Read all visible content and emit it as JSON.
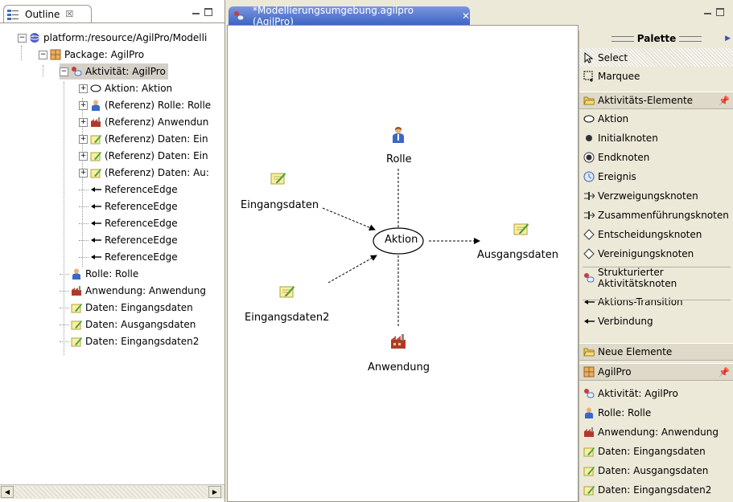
{
  "outline": {
    "tab_label": "Outline",
    "tab_close": "☒",
    "tree": [
      {
        "label": "platform:/resource/AgilPro/Modelli",
        "icon": "platform-icon",
        "expander": "−"
      },
      {
        "label": "Package: AgilPro",
        "icon": "package-icon",
        "expander": "−"
      },
      {
        "label": "Aktivität: AgilPro",
        "icon": "activity-icon",
        "expander": "−"
      },
      {
        "label": "Aktion: Aktion",
        "icon": "action-icon",
        "expander": "+"
      },
      {
        "label": "(Referenz) Rolle: Rolle",
        "icon": "role-icon",
        "expander": "+"
      },
      {
        "label": "(Referenz) Anwendun",
        "icon": "application-icon",
        "expander": "+"
      },
      {
        "label": "(Referenz) Daten: Ein",
        "icon": "data-icon",
        "expander": "+"
      },
      {
        "label": "(Referenz) Daten: Ein",
        "icon": "data-icon",
        "expander": "+"
      },
      {
        "label": "(Referenz) Daten: Au:",
        "icon": "data-icon",
        "expander": "+"
      },
      {
        "label": "ReferenceEdge",
        "icon": "edge-icon"
      },
      {
        "label": "ReferenceEdge",
        "icon": "edge-icon"
      },
      {
        "label": "ReferenceEdge",
        "icon": "edge-icon"
      },
      {
        "label": "ReferenceEdge",
        "icon": "edge-icon"
      },
      {
        "label": "ReferenceEdge",
        "icon": "edge-icon"
      },
      {
        "label": "Rolle: Rolle",
        "icon": "role-icon"
      },
      {
        "label": "Anwendung: Anwendung",
        "icon": "application-icon"
      },
      {
        "label": "Daten: Eingangsdaten",
        "icon": "data-icon"
      },
      {
        "label": "Daten: Ausgangsdaten",
        "icon": "data-icon"
      },
      {
        "label": "Daten: Eingangsdaten2",
        "icon": "data-icon"
      }
    ]
  },
  "editor": {
    "tab_label": "*Modellierungsumgebung.agilpro (AgilPro)",
    "tab_close": "✕",
    "diagram": {
      "action": "Aktion",
      "role": "Rolle",
      "input1": "Eingangsdaten",
      "input2": "Eingangsdaten2",
      "output": "Ausgangsdaten",
      "application": "Anwendung"
    }
  },
  "palette": {
    "title": "Palette",
    "tools": [
      {
        "label": "Select",
        "icon": "cursor-icon"
      },
      {
        "label": "Marquee",
        "icon": "marquee-icon"
      }
    ],
    "drawer1": {
      "label": "Aktivitäts-Elemente",
      "items": [
        {
          "label": "Aktion",
          "icon": "action-icon"
        },
        {
          "label": "Initialknoten",
          "icon": "initial-node-icon"
        },
        {
          "label": "Endknoten",
          "icon": "final-node-icon"
        },
        {
          "label": "Ereignis",
          "icon": "event-icon"
        },
        {
          "label": "Verzweigungsknoten",
          "icon": "fork-icon"
        },
        {
          "label": "Zusammenführungsknoten",
          "icon": "join-icon"
        },
        {
          "label": "Entscheidungsknoten",
          "icon": "decision-icon"
        },
        {
          "label": "Vereinigungsknoten",
          "icon": "merge-icon"
        },
        {
          "label": "Strukturierter Aktivitätsknoten",
          "icon": "structured-activity-icon"
        },
        {
          "label": "Aktions-Transition",
          "icon": "transition-icon"
        },
        {
          "label": "Verbindung",
          "icon": "connection-icon"
        }
      ]
    },
    "drawer2": {
      "label": "Neue Elemente"
    },
    "drawer3": {
      "label": "AgilPro",
      "items": [
        {
          "label": "Aktivität: AgilPro",
          "icon": "activity-icon"
        },
        {
          "label": "Rolle: Rolle",
          "icon": "role-icon"
        },
        {
          "label": "Anwendung: Anwendung",
          "icon": "application-icon"
        },
        {
          "label": "Daten: Eingangsdaten",
          "icon": "data-icon"
        },
        {
          "label": "Daten: Ausgangsdaten",
          "icon": "data-icon"
        },
        {
          "label": "Daten: Eingangsdaten2",
          "icon": "data-icon"
        }
      ]
    }
  },
  "colors": {
    "editor_tab": "#3e64c4",
    "selection": "#d4d0c8",
    "background": "#ece9d8"
  }
}
